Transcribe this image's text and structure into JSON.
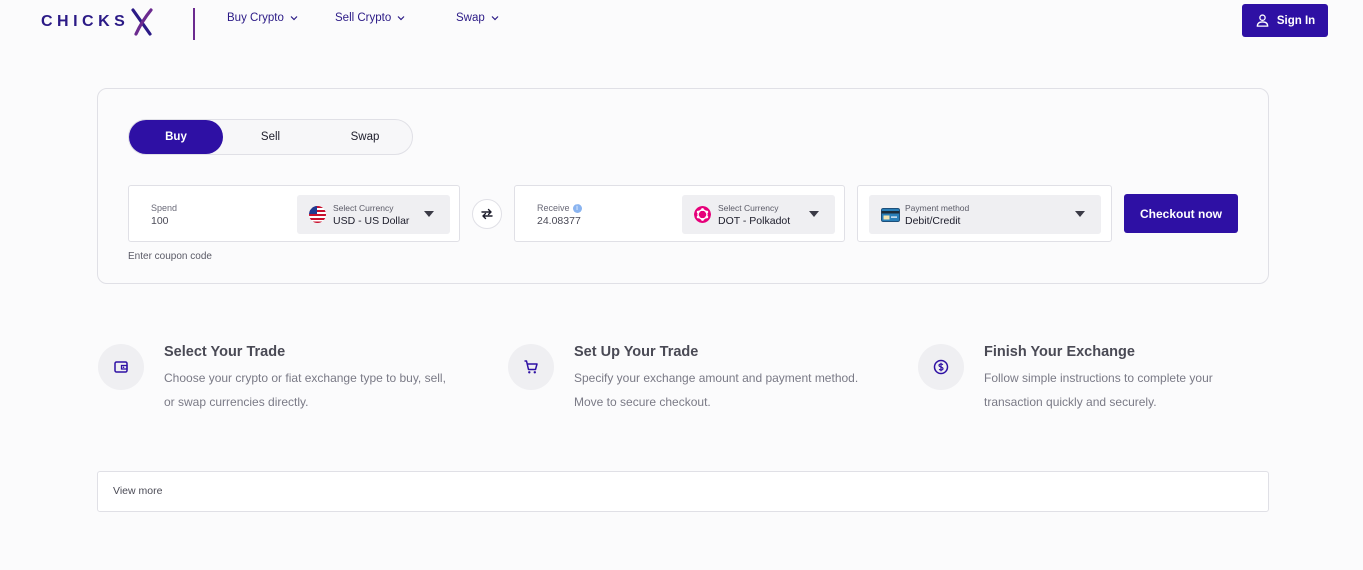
{
  "header": {
    "logo_text": "CHICKS",
    "nav": [
      {
        "label": "Buy Crypto"
      },
      {
        "label": "Sell Crypto"
      },
      {
        "label": "Swap"
      }
    ],
    "signin_label": "Sign In"
  },
  "trade": {
    "tabs": [
      {
        "label": "Buy",
        "active": true
      },
      {
        "label": "Sell",
        "active": false
      },
      {
        "label": "Swap",
        "active": false
      }
    ],
    "spend": {
      "label": "Spend",
      "value": "100",
      "currency_label": "Select Currency",
      "currency_value": "USD - US Dollar",
      "icon": "us-flag-icon"
    },
    "receive": {
      "label": "Receive",
      "value": "24.08377",
      "currency_label": "Select Currency",
      "currency_value": "DOT - Polkadot",
      "icon": "polkadot-icon"
    },
    "payment": {
      "label": "Payment method",
      "value": "Debit/Credit",
      "icon": "card-icon"
    },
    "checkout_label": "Checkout now",
    "coupon_label": "Enter coupon code"
  },
  "steps": [
    {
      "title": "Select Your Trade",
      "desc": "Choose your crypto or fiat exchange type to buy, sell, or swap currencies directly.",
      "icon": "wallet-icon"
    },
    {
      "title": "Set Up Your Trade",
      "desc": "Specify your exchange amount and payment method. Move to secure checkout.",
      "icon": "cart-icon"
    },
    {
      "title": "Finish Your Exchange",
      "desc": "Follow simple instructions to complete your transaction quickly and securely.",
      "icon": "dollar-icon"
    }
  ],
  "view_more_label": "View more",
  "colors": {
    "accent": "#2e10a4",
    "background": "#fbfbfc",
    "polkadot": "#e6007a"
  }
}
